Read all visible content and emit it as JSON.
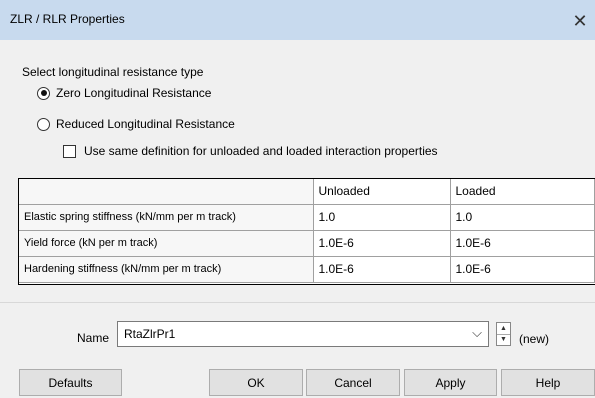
{
  "window": {
    "title": "ZLR / RLR Properties",
    "close_glyph": "✕"
  },
  "resistance": {
    "section_label": "Select longitudinal resistance type",
    "options": [
      {
        "label": "Zero Longitudinal Resistance",
        "selected": true
      },
      {
        "label": "Reduced Longitudinal Resistance",
        "selected": false
      }
    ],
    "same_definition": {
      "label": "Use same definition for unloaded and loaded interaction properties",
      "checked": false
    }
  },
  "grid": {
    "columns": [
      "",
      "Unloaded",
      "Loaded"
    ],
    "rows": [
      {
        "label": "Elastic spring stiffness (kN/mm per m track)",
        "unloaded": "1.0",
        "loaded": "1.0"
      },
      {
        "label": "Yield force (kN per m track)",
        "unloaded": "1.0E-6",
        "loaded": "1.0E-6"
      },
      {
        "label": "Hardening stiffness (kN/mm per m track)",
        "unloaded": "1.0E-6",
        "loaded": "1.0E-6"
      }
    ]
  },
  "name_field": {
    "label": "Name",
    "value": "RtaZlrPr1",
    "new_label": "(new)",
    "dropdown_icon": "chevron-down-icon",
    "spinner_icon": "spinner-icon"
  },
  "buttons": {
    "defaults": "Defaults",
    "ok": "OK",
    "cancel": "Cancel",
    "apply": "Apply",
    "help": "Help"
  },
  "colors": {
    "titlebar": "#c8daee",
    "dialog_bg": "#f0f0f0",
    "button_bg": "#e1e1e1",
    "grid_bg": "#ffffff"
  }
}
